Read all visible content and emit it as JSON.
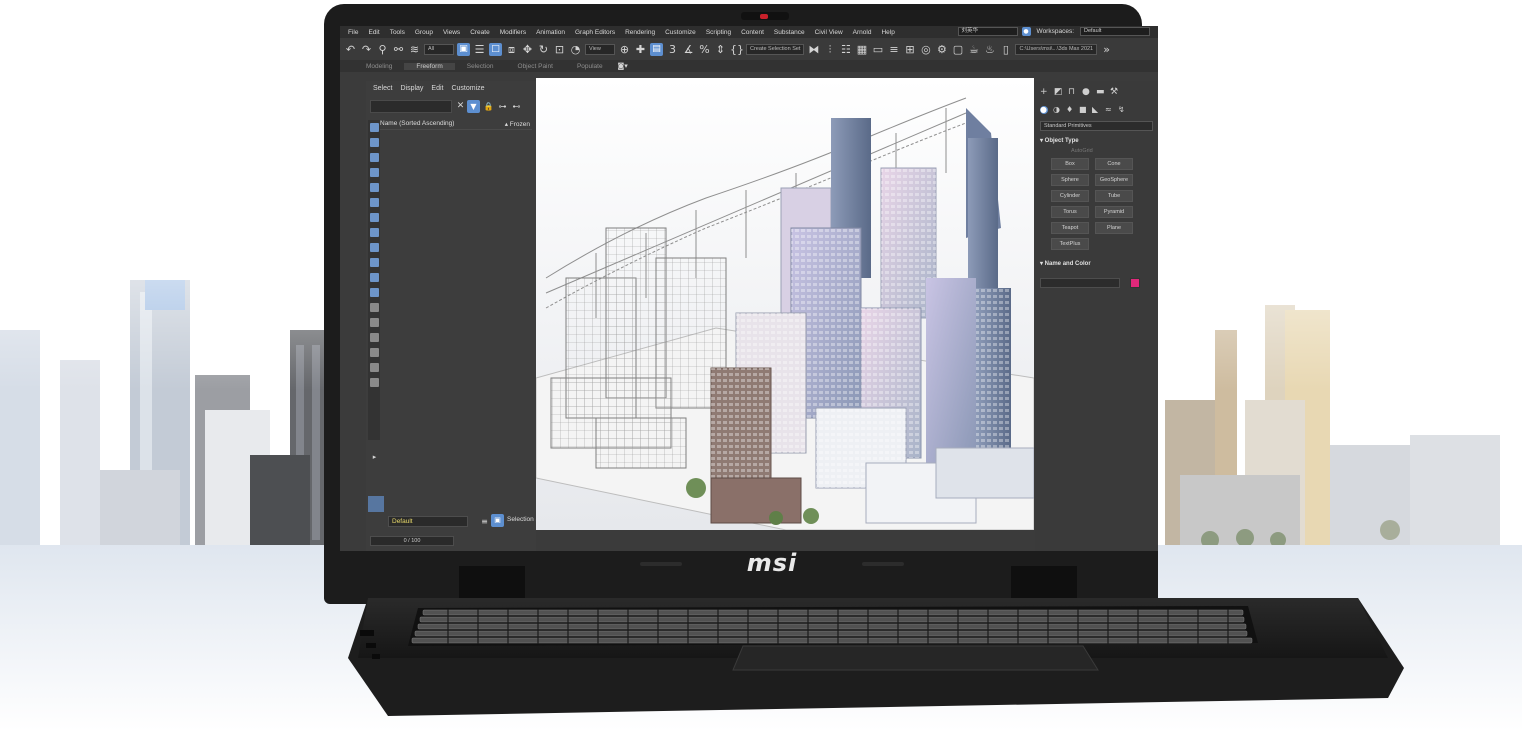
{
  "brand": {
    "logo_text": "msi"
  },
  "app": {
    "menu": [
      "File",
      "Edit",
      "Tools",
      "Group",
      "Views",
      "Create",
      "Modifiers",
      "Animation",
      "Graph Editors",
      "Rendering",
      "Customize",
      "Scripting",
      "Content",
      "Substance",
      "Civil View",
      "Arnold",
      "Help"
    ],
    "workspaces_label": "Workspaces:",
    "workspace_value": "Default",
    "user_field": "刘英华",
    "toolbar": {
      "filter_dropdown": "All",
      "view_dropdown": "View",
      "selection_set_dropdown": "Create Selection Set",
      "path_field": "C:\\Users\\msi\\...\\3ds Max 2021"
    },
    "ribbon_tabs": [
      "Modeling",
      "Freeform",
      "Selection",
      "Object Paint",
      "Populate"
    ],
    "ribbon_active": "Freeform",
    "scene_explorer": {
      "menu": [
        "Select",
        "Display",
        "Edit",
        "Customize"
      ],
      "column_name": "Name (Sorted Ascending)",
      "column_frozen": "▴ Frozen",
      "layer_value": "Default",
      "selection_set_label": "Selection Set:",
      "frame_counter": "0 / 100"
    },
    "command_panel": {
      "category_dropdown": "Standard Primitives",
      "object_type_title": "▾ Object Type",
      "autogrid_label": "AutoGrid",
      "buttons": [
        "Box",
        "Cone",
        "Sphere",
        "GeoSphere",
        "Cylinder",
        "Tube",
        "Torus",
        "Pyramid",
        "Teapot",
        "Plane",
        "TextPlus"
      ],
      "name_color_title": "▾ Name and Color",
      "object_color": "#e0287a"
    }
  },
  "colors": {
    "accent_blue": "#5d8fd0",
    "ui_dark": "#3b3b3b",
    "laptop_body": "#1c1c1c"
  }
}
